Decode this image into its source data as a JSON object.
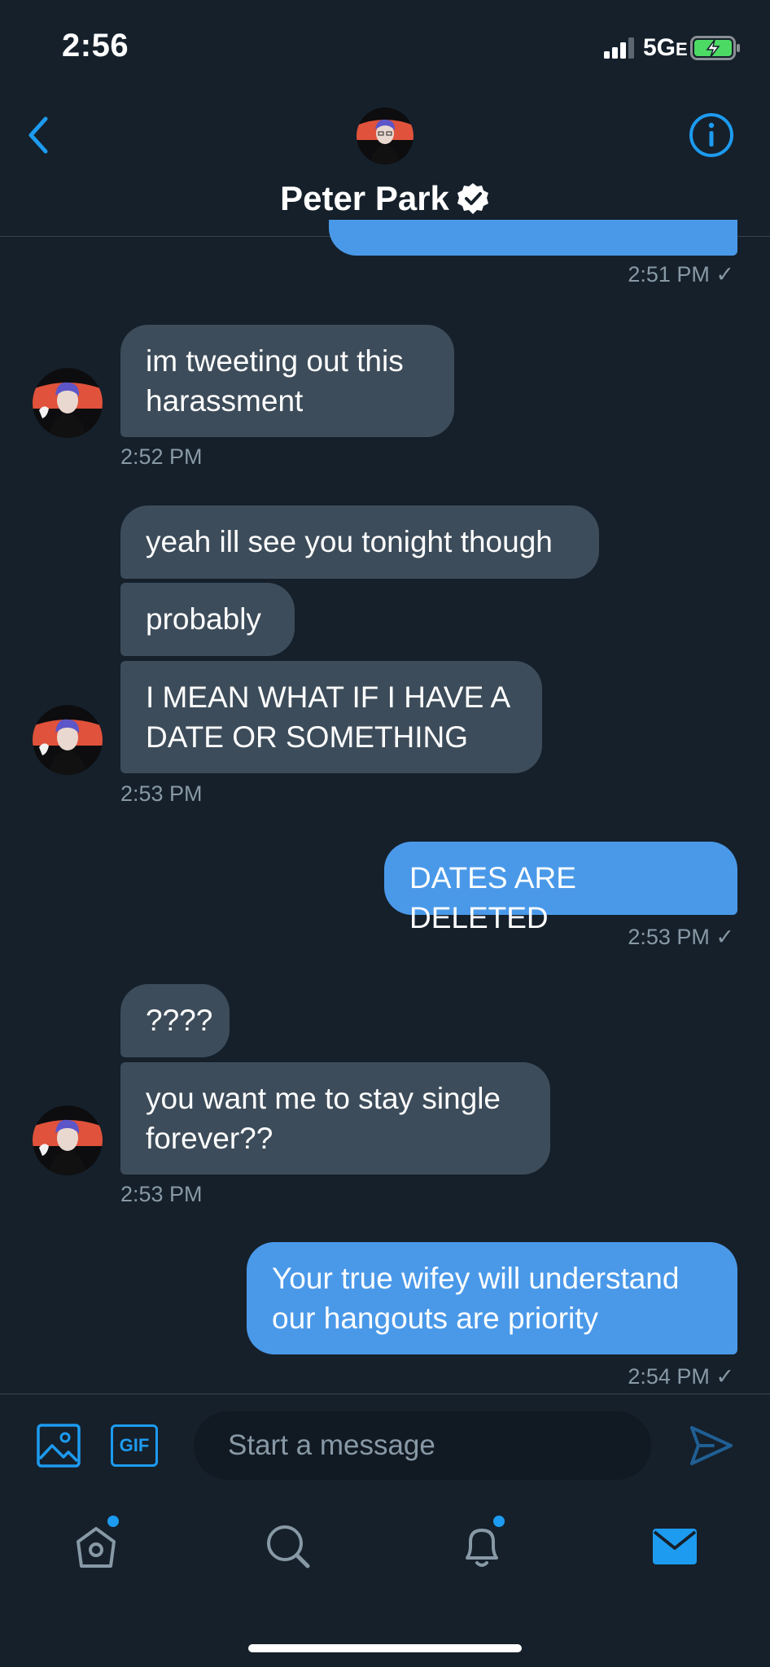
{
  "status_bar": {
    "time": "2:56",
    "network": "5G",
    "network_suffix": "E"
  },
  "header": {
    "contact_name": "Peter Park",
    "verified": true
  },
  "messages": [
    {
      "type": "sent-fragment",
      "timestamp": "2:51 PM ✓"
    },
    {
      "type": "received",
      "text": "im tweeting out this harassment",
      "timestamp": "2:52 PM"
    },
    {
      "type": "received",
      "text": "yeah ill see you tonight though"
    },
    {
      "type": "received",
      "text": "probably"
    },
    {
      "type": "received",
      "text": "I MEAN WHAT IF I HAVE A DATE OR SOMETHING",
      "timestamp": "2:53 PM"
    },
    {
      "type": "sent",
      "text": "DATES ARE DELETED",
      "timestamp": "2:53 PM ✓"
    },
    {
      "type": "received",
      "text": "????"
    },
    {
      "type": "received",
      "text": "you want me to stay single forever??",
      "timestamp": "2:53 PM"
    },
    {
      "type": "sent",
      "text": "Your true wifey will understand our hangouts are priority",
      "timestamp": "2:54 PM ✓"
    }
  ],
  "composer": {
    "placeholder": "Start a message",
    "gif_label": "GIF"
  },
  "nav": {
    "home_icon": "home-icon",
    "search_icon": "search-icon",
    "notifications_icon": "bell-icon",
    "messages_icon": "mail-icon"
  },
  "colors": {
    "background": "#15202b",
    "received_bubble": "#3d4c5a",
    "sent_bubble": "#4a99e9",
    "accent": "#1d9bf0",
    "muted_text": "#8899a6"
  }
}
